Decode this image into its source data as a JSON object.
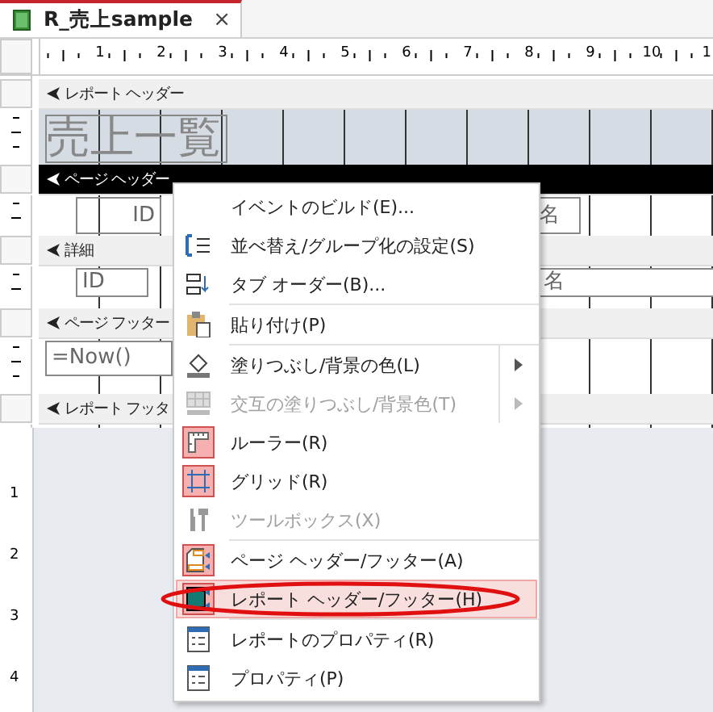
{
  "tab": {
    "title": "R_売上sample",
    "close": "×",
    "selected": true
  },
  "ruler": {
    "h_labels": [
      "1",
      "2",
      "3",
      "4",
      "5",
      "6",
      "7",
      "8",
      "9",
      "10",
      "1"
    ],
    "v_labels": [
      "1",
      "2",
      "3",
      "4"
    ]
  },
  "sections": [
    {
      "label": "レポート ヘッダー",
      "selected": false,
      "kind": "title",
      "controls": [
        {
          "text": "売上一覧"
        }
      ]
    },
    {
      "label": "ページ ヘッダー",
      "selected": true,
      "kind": "labels",
      "controls": [
        {
          "text": "ID"
        },
        {
          "text": "名"
        }
      ]
    },
    {
      "label": "詳細",
      "selected": false,
      "kind": "fields",
      "controls": [
        {
          "text": "ID"
        },
        {
          "text": "名"
        }
      ]
    },
    {
      "label": "ページ フッター",
      "selected": false,
      "kind": "footer",
      "controls": [
        {
          "text": "=Now()"
        }
      ]
    },
    {
      "label": "レポート フッタ",
      "selected": false,
      "kind": "end"
    }
  ],
  "menu": [
    {
      "kind": "item",
      "label": "イベントのビルド(E)...",
      "disabled": false,
      "checked": false,
      "highlighted": false,
      "submenu": false
    },
    {
      "kind": "item",
      "label": "並べ替え/グループ化の設定(S)",
      "disabled": false,
      "checked": false,
      "highlighted": false,
      "submenu": false
    },
    {
      "kind": "item",
      "label": "タブ オーダー(B)...",
      "disabled": false,
      "checked": false,
      "highlighted": false,
      "submenu": false
    },
    {
      "kind": "separator"
    },
    {
      "kind": "item",
      "label": "貼り付け(P)",
      "disabled": false,
      "checked": false,
      "highlighted": false,
      "submenu": false
    },
    {
      "kind": "separator"
    },
    {
      "kind": "item",
      "label": "塗りつぶし/背景の色(L)",
      "disabled": false,
      "checked": false,
      "highlighted": false,
      "submenu": true
    },
    {
      "kind": "item",
      "label": "交互の塗りつぶし/背景色(T)",
      "disabled": true,
      "checked": false,
      "highlighted": false,
      "submenu": true
    },
    {
      "kind": "item",
      "label": "ルーラー(R)",
      "disabled": false,
      "checked": true,
      "highlighted": false,
      "submenu": false
    },
    {
      "kind": "item",
      "label": "グリッド(R)",
      "disabled": false,
      "checked": true,
      "highlighted": false,
      "submenu": false
    },
    {
      "kind": "item",
      "label": "ツールボックス(X)",
      "disabled": true,
      "checked": false,
      "highlighted": false,
      "submenu": false
    },
    {
      "kind": "separator"
    },
    {
      "kind": "item",
      "label": "ページ ヘッダー/フッター(A)",
      "disabled": false,
      "checked": true,
      "highlighted": false,
      "submenu": false
    },
    {
      "kind": "item",
      "label": "レポート ヘッダー/フッター(H)",
      "disabled": false,
      "checked": true,
      "highlighted": true,
      "submenu": false
    },
    {
      "kind": "separator"
    },
    {
      "kind": "item",
      "label": "レポートのプロパティ(R)",
      "disabled": false,
      "checked": false,
      "highlighted": false,
      "submenu": false
    },
    {
      "kind": "item",
      "label": "プロパティ(P)",
      "disabled": false,
      "checked": false,
      "highlighted": false,
      "submenu": false
    }
  ]
}
